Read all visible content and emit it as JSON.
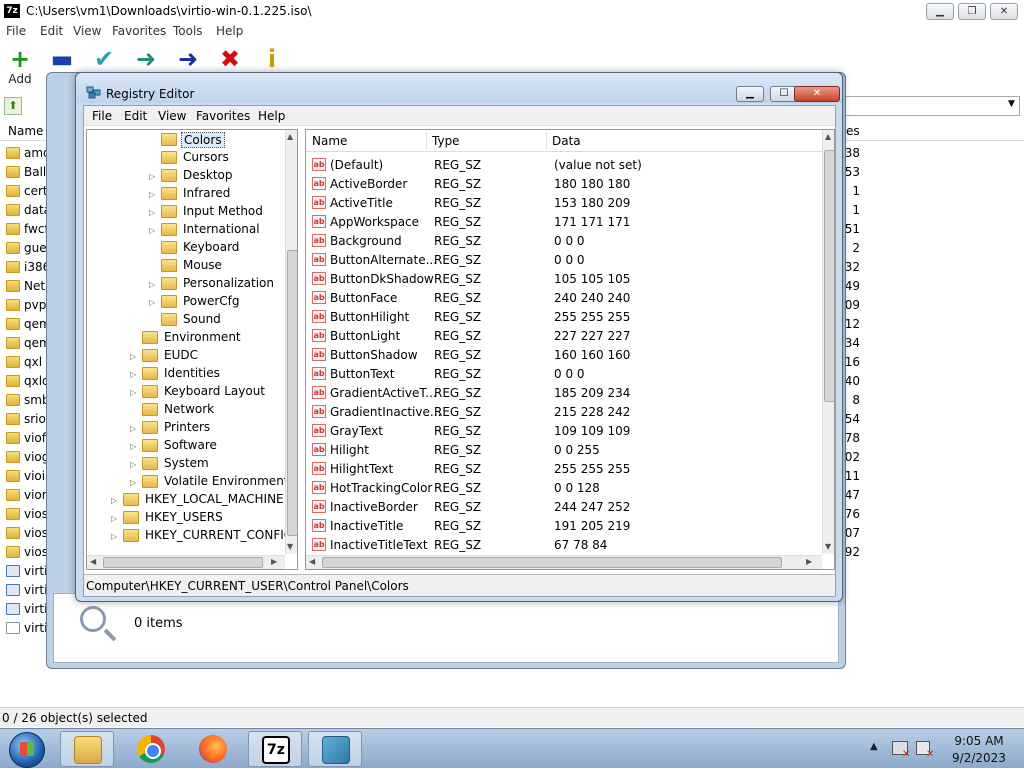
{
  "sevenzip": {
    "title": "C:\\Users\\vm1\\Downloads\\virtio-win-0.1.225.iso\\",
    "app_icon": "7z",
    "menu": [
      "File",
      "Edit",
      "View",
      "Favorites",
      "Tools",
      "Help"
    ],
    "toolbar": {
      "add_label": "Add",
      "buttons": [
        {
          "icon": "add-icon",
          "glyph": "+",
          "color": "#1a9a1a"
        },
        {
          "icon": "extract-icon",
          "glyph": "▬",
          "color": "#1c3fb0"
        },
        {
          "icon": "test-icon",
          "glyph": "✔",
          "color": "#2aa0b8"
        },
        {
          "icon": "copy-icon",
          "glyph": "➜",
          "color": "#2a8a7a"
        },
        {
          "icon": "move-icon",
          "glyph": "➜",
          "color": "#1c2fa0"
        },
        {
          "icon": "delete-icon",
          "glyph": "✖",
          "color": "#d01010"
        },
        {
          "icon": "info-icon",
          "glyph": "i",
          "color": "#c8a000"
        }
      ]
    },
    "list_header": {
      "name": "Name",
      "size_partial": "es"
    },
    "rows": [
      {
        "name": "amd",
        "size": "38",
        "kind": "folder"
      },
      {
        "name": "Ballo",
        "size": "53",
        "kind": "folder"
      },
      {
        "name": "cert",
        "size": "1",
        "kind": "folder"
      },
      {
        "name": "data",
        "size": "1",
        "kind": "folder"
      },
      {
        "name": "fwcf",
        "size": "51",
        "kind": "folder"
      },
      {
        "name": "gues",
        "size": "2",
        "kind": "folder"
      },
      {
        "name": "i386",
        "size": "32",
        "kind": "folder"
      },
      {
        "name": "Neth",
        "size": "49",
        "kind": "folder"
      },
      {
        "name": "pvpa",
        "size": "09",
        "kind": "folder"
      },
      {
        "name": "qem",
        "size": "12",
        "kind": "folder"
      },
      {
        "name": "qem",
        "size": "34",
        "kind": "folder"
      },
      {
        "name": "qxl",
        "size": "16",
        "kind": "folder"
      },
      {
        "name": "qxld",
        "size": "40",
        "kind": "folder"
      },
      {
        "name": "smb",
        "size": "8",
        "kind": "folder"
      },
      {
        "name": "sriov",
        "size": "54",
        "kind": "folder"
      },
      {
        "name": "viofs",
        "size": "78",
        "kind": "folder"
      },
      {
        "name": "viog",
        "size": "02",
        "kind": "folder"
      },
      {
        "name": "vioin",
        "size": "11",
        "kind": "folder"
      },
      {
        "name": "vion",
        "size": "47",
        "kind": "folder"
      },
      {
        "name": "vios",
        "size": "76",
        "kind": "folder"
      },
      {
        "name": "vios",
        "size": "07",
        "kind": "folder"
      },
      {
        "name": "vios",
        "size": "92",
        "kind": "folder"
      },
      {
        "name": "virtio",
        "size": "",
        "kind": "exe"
      },
      {
        "name": "virtio",
        "size": "",
        "kind": "exe"
      },
      {
        "name": "virtio",
        "size": "",
        "kind": "exe"
      },
      {
        "name": "virtio",
        "size": "",
        "kind": "file"
      }
    ],
    "status": "0 / 26 object(s) selected"
  },
  "background_dialog": {
    "items_text": "0 items"
  },
  "regedit": {
    "title": "Registry Editor",
    "menu": [
      "File",
      "Edit",
      "View",
      "Favorites",
      "Help"
    ],
    "tree": [
      {
        "label": "Colors",
        "indent": 3,
        "expander": "",
        "selected": true
      },
      {
        "label": "Cursors",
        "indent": 3,
        "expander": ""
      },
      {
        "label": "Desktop",
        "indent": 3,
        "expander": "▷"
      },
      {
        "label": "Infrared",
        "indent": 3,
        "expander": "▷"
      },
      {
        "label": "Input Method",
        "indent": 3,
        "expander": "▷"
      },
      {
        "label": "International",
        "indent": 3,
        "expander": "▷"
      },
      {
        "label": "Keyboard",
        "indent": 3,
        "expander": ""
      },
      {
        "label": "Mouse",
        "indent": 3,
        "expander": ""
      },
      {
        "label": "Personalization",
        "indent": 3,
        "expander": "▷"
      },
      {
        "label": "PowerCfg",
        "indent": 3,
        "expander": "▷"
      },
      {
        "label": "Sound",
        "indent": 3,
        "expander": ""
      },
      {
        "label": "Environment",
        "indent": 2,
        "expander": ""
      },
      {
        "label": "EUDC",
        "indent": 2,
        "expander": "▷"
      },
      {
        "label": "Identities",
        "indent": 2,
        "expander": "▷"
      },
      {
        "label": "Keyboard Layout",
        "indent": 2,
        "expander": "▷"
      },
      {
        "label": "Network",
        "indent": 2,
        "expander": ""
      },
      {
        "label": "Printers",
        "indent": 2,
        "expander": "▷"
      },
      {
        "label": "Software",
        "indent": 2,
        "expander": "▷"
      },
      {
        "label": "System",
        "indent": 2,
        "expander": "▷"
      },
      {
        "label": "Volatile Environment",
        "indent": 2,
        "expander": "▷"
      },
      {
        "label": "HKEY_LOCAL_MACHINE",
        "indent": 1,
        "expander": "▷"
      },
      {
        "label": "HKEY_USERS",
        "indent": 1,
        "expander": "▷"
      },
      {
        "label": "HKEY_CURRENT_CONFIG",
        "indent": 1,
        "expander": "▷"
      }
    ],
    "columns": [
      "Name",
      "Type",
      "Data"
    ],
    "values": [
      {
        "name": "(Default)",
        "type": "REG_SZ",
        "data": "(value not set)"
      },
      {
        "name": "ActiveBorder",
        "type": "REG_SZ",
        "data": "180 180 180"
      },
      {
        "name": "ActiveTitle",
        "type": "REG_SZ",
        "data": "153 180 209"
      },
      {
        "name": "AppWorkspace",
        "type": "REG_SZ",
        "data": "171 171 171"
      },
      {
        "name": "Background",
        "type": "REG_SZ",
        "data": "0 0 0"
      },
      {
        "name": "ButtonAlternate...",
        "type": "REG_SZ",
        "data": "0 0 0"
      },
      {
        "name": "ButtonDkShadow",
        "type": "REG_SZ",
        "data": "105 105 105"
      },
      {
        "name": "ButtonFace",
        "type": "REG_SZ",
        "data": "240 240 240"
      },
      {
        "name": "ButtonHilight",
        "type": "REG_SZ",
        "data": "255 255 255"
      },
      {
        "name": "ButtonLight",
        "type": "REG_SZ",
        "data": "227 227 227"
      },
      {
        "name": "ButtonShadow",
        "type": "REG_SZ",
        "data": "160 160 160"
      },
      {
        "name": "ButtonText",
        "type": "REG_SZ",
        "data": "0 0 0"
      },
      {
        "name": "GradientActiveT...",
        "type": "REG_SZ",
        "data": "185 209 234"
      },
      {
        "name": "GradientInactive...",
        "type": "REG_SZ",
        "data": "215 228 242"
      },
      {
        "name": "GrayText",
        "type": "REG_SZ",
        "data": "109 109 109"
      },
      {
        "name": "Hilight",
        "type": "REG_SZ",
        "data": "0 0 255"
      },
      {
        "name": "HilightText",
        "type": "REG_SZ",
        "data": "255 255 255"
      },
      {
        "name": "HotTrackingColor",
        "type": "REG_SZ",
        "data": "0 0 128"
      },
      {
        "name": "InactiveBorder",
        "type": "REG_SZ",
        "data": "244 247 252"
      },
      {
        "name": "InactiveTitle",
        "type": "REG_SZ",
        "data": "191 205 219"
      },
      {
        "name": "InactiveTitleText",
        "type": "REG_SZ",
        "data": "67 78 84"
      }
    ],
    "status_path": "Computer\\HKEY_CURRENT_USER\\Control Panel\\Colors"
  },
  "taskbar": {
    "seven_zip_label": "7z",
    "time": "9:05 AM",
    "date": "9/2/2023",
    "tray_arrow": "▲"
  }
}
